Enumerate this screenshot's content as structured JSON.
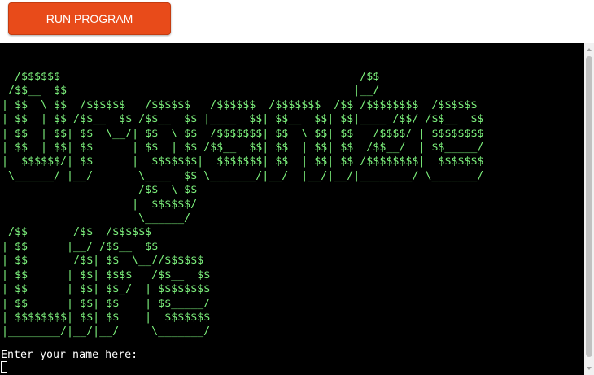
{
  "run_button": {
    "label": "RUN PROGRAM"
  },
  "terminal": {
    "banner": "  /$$$$$$                                              /$$\n /$$__  $$                                            |__/\n| $$  \\ $$  /$$$$$$   /$$$$$$   /$$$$$$  /$$$$$$$  /$$ /$$$$$$$$  /$$$$$$\n| $$  | $$ /$$__  $$ /$$__  $$ |____  $$| $$__  $$| $$|____ /$$/ /$$__  $$\n| $$  | $$| $$  \\__/| $$  \\ $$  /$$$$$$$| $$  \\ $$| $$   /$$$$/ | $$$$$$$$\n| $$  | $$| $$      | $$  | $$ /$$__  $$| $$  | $$| $$  /$$__/  | $$_____/\n|  $$$$$$/| $$      |  $$$$$$$|  $$$$$$$| $$  | $$| $$ /$$$$$$$$|  $$$$$$$\n \\______/ |__/       \\____  $$ \\_______/|__/  |__/|__/|________/ \\_______/\n                     /$$  \\ $$\n                    |  $$$$$$/\n                     \\______/\n /$$       /$$  /$$$$$$\n| $$      |__/ /$$__  $$\n| $$       /$$| $$  \\__//$$$$$$\n| $$      | $$| $$$$   /$$__  $$\n| $$      | $$| $$_/  | $$$$$$$$\n| $$      | $$| $$    | $$_____/\n| $$$$$$$$| $$| $$    |  $$$$$$$\n|________/|__/|__/     \\_______/",
    "prompt": "Enter your name here:",
    "text_color": "#7cf07c",
    "background": "#000000"
  },
  "colors": {
    "accent": "#e84b1a"
  }
}
